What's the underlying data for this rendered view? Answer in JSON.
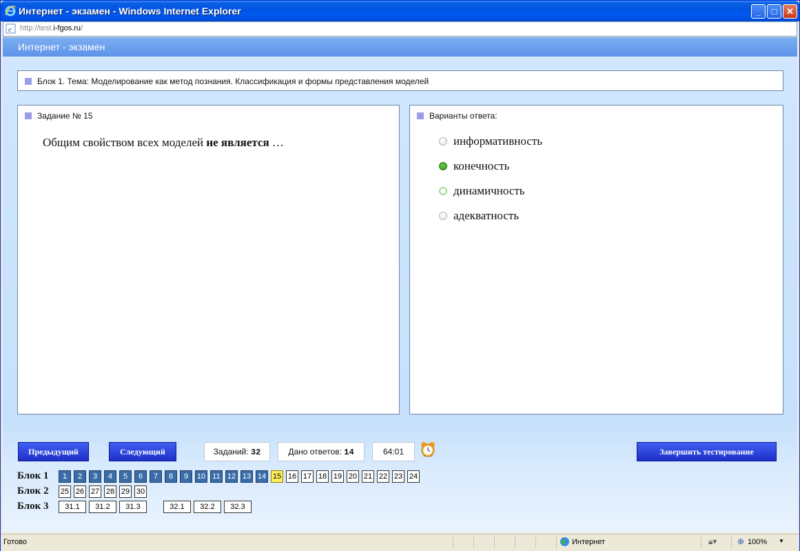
{
  "window": {
    "title": "Интернет - экзамен - Windows Internet Explorer",
    "url_prefix": "http://test.",
    "url_host": "i-fgos.ru",
    "url_suffix": "/"
  },
  "app": {
    "header": "Интернет - экзамен"
  },
  "block_title": "Блок 1. Тема: Моделирование как метод познания. Классификация и формы представления моделей",
  "task": {
    "label": "Задание № 15",
    "question_start": "Общим свойством всех моделей ",
    "question_bold": "не является",
    "question_end": " …"
  },
  "answers": {
    "label": "Варианты ответа:",
    "options": [
      {
        "text": "информативность",
        "state": "unchecked"
      },
      {
        "text": "конечность",
        "state": "checked"
      },
      {
        "text": "динамичность",
        "state": "hover"
      },
      {
        "text": "адекватность",
        "state": "unchecked"
      }
    ]
  },
  "controls": {
    "prev": "Предыдущий",
    "next": "Следующий",
    "tasks_label": "Заданий:",
    "tasks_count": "32",
    "answered_label": "Дано ответов:",
    "answered_count": "14",
    "timer": "64:01",
    "finish": "Завершить тестирование"
  },
  "blocks": [
    {
      "label": "Блок 1",
      "items": [
        "1",
        "2",
        "3",
        "4",
        "5",
        "6",
        "7",
        "8",
        "9",
        "10",
        "11",
        "12",
        "13",
        "14",
        "15",
        "16",
        "17",
        "18",
        "19",
        "20",
        "21",
        "22",
        "23",
        "24"
      ],
      "answered_through": 14,
      "current": "15"
    },
    {
      "label": "Блок 2",
      "items": [
        "25",
        "26",
        "27",
        "28",
        "29",
        "30"
      ]
    },
    {
      "label": "Блок 3",
      "items": [
        "31.1",
        "31.2",
        "31.3",
        "32.1",
        "32.2",
        "32.3"
      ]
    }
  ],
  "statusbar": {
    "status": "Готово",
    "zone": "Интернет",
    "zoom": "100%"
  }
}
